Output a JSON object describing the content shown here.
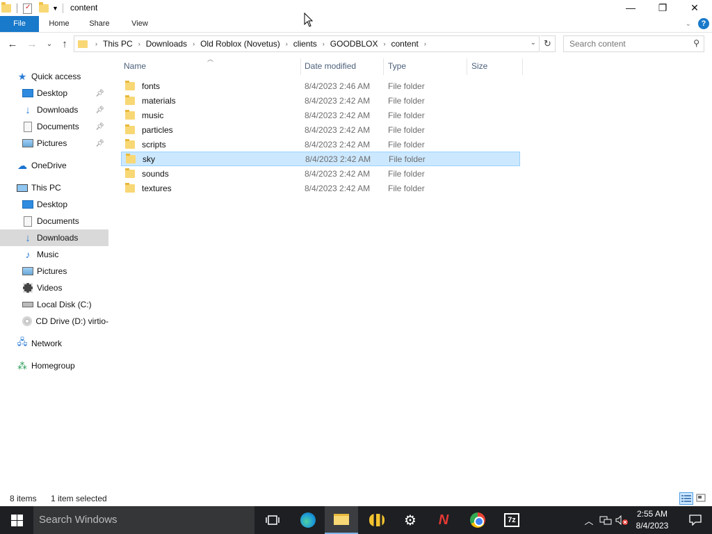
{
  "window": {
    "title": "content",
    "controls": {
      "minimize": "—",
      "maximize": "❐",
      "close": "✕"
    }
  },
  "ribbon": {
    "tabs": [
      "File",
      "Home",
      "Share",
      "View"
    ]
  },
  "address": {
    "crumbs": [
      "This PC",
      "Downloads",
      "Old Roblox (Novetus)",
      "clients",
      "GOODBLOX",
      "content"
    ]
  },
  "search": {
    "placeholder": "Search content"
  },
  "nav": {
    "quick_access": "Quick access",
    "quick_items": [
      "Desktop",
      "Downloads",
      "Documents",
      "Pictures"
    ],
    "onedrive": "OneDrive",
    "this_pc": "This PC",
    "pc_items": [
      "Desktop",
      "Documents",
      "Downloads",
      "Music",
      "Pictures",
      "Videos",
      "Local Disk (C:)",
      "CD Drive (D:) virtio-"
    ],
    "network": "Network",
    "homegroup": "Homegroup"
  },
  "columns": {
    "name": "Name",
    "date": "Date modified",
    "type": "Type",
    "size": "Size"
  },
  "files": [
    {
      "name": "fonts",
      "date": "8/4/2023 2:46 AM",
      "type": "File folder",
      "selected": false
    },
    {
      "name": "materials",
      "date": "8/4/2023 2:42 AM",
      "type": "File folder",
      "selected": false
    },
    {
      "name": "music",
      "date": "8/4/2023 2:42 AM",
      "type": "File folder",
      "selected": false
    },
    {
      "name": "particles",
      "date": "8/4/2023 2:42 AM",
      "type": "File folder",
      "selected": false
    },
    {
      "name": "scripts",
      "date": "8/4/2023 2:42 AM",
      "type": "File folder",
      "selected": false
    },
    {
      "name": "sky",
      "date": "8/4/2023 2:42 AM",
      "type": "File folder",
      "selected": true
    },
    {
      "name": "sounds",
      "date": "8/4/2023 2:42 AM",
      "type": "File folder",
      "selected": false
    },
    {
      "name": "textures",
      "date": "8/4/2023 2:42 AM",
      "type": "File folder",
      "selected": false
    }
  ],
  "status": {
    "count": "8 items",
    "selection": "1 item selected"
  },
  "taskbar": {
    "search_placeholder": "Search Windows",
    "apps": [
      "task-view",
      "edge",
      "file-explorer",
      "bee-app",
      "settings",
      "novetus",
      "chrome",
      "7zip"
    ],
    "clock_time": "2:55 AM",
    "clock_date": "8/4/2023"
  },
  "colors": {
    "accent": "#1979ca",
    "selection_bg": "#cce8ff",
    "selection_border": "#99d1ff",
    "folder": "#f8d775",
    "taskbar": "#1d1f22"
  }
}
